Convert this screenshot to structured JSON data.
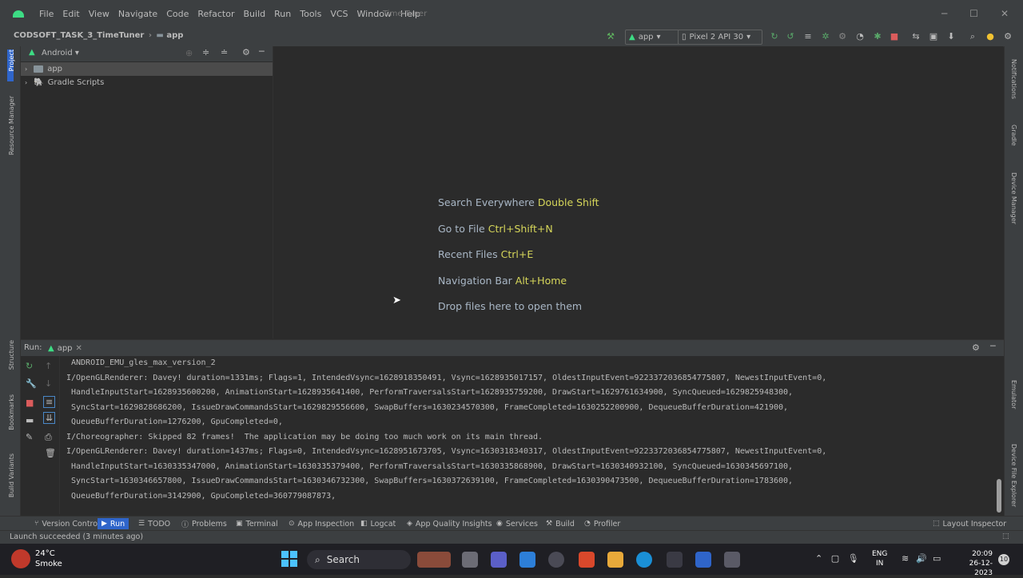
{
  "menu": [
    "File",
    "Edit",
    "View",
    "Navigate",
    "Code",
    "Refactor",
    "Build",
    "Run",
    "Tools",
    "VCS",
    "Window",
    "Help"
  ],
  "window_title": "Time Tuner",
  "breadcrumb": {
    "project": "CODSOFT_TASK_3_TimeTuner",
    "module": "app"
  },
  "toolbar": {
    "run_config": "app",
    "device": "Pixel 2 API 30"
  },
  "project_panel": {
    "view": "Android",
    "items": [
      {
        "label": "app"
      },
      {
        "label": "Gradle Scripts"
      }
    ]
  },
  "left_stripe": {
    "project": "Project",
    "resource_manager": "Resource Manager",
    "structure": "Structure",
    "bookmarks": "Bookmarks",
    "build_variants": "Build Variants"
  },
  "right_stripe": {
    "notifications": "Notifications",
    "gradle": "Gradle",
    "device_manager": "Device Manager",
    "emulator": "Emulator",
    "device_file_explorer": "Device File Explorer"
  },
  "editor_hints": [
    {
      "label": "Search Everywhere",
      "key": "Double Shift"
    },
    {
      "label": "Go to File",
      "key": "Ctrl+Shift+N"
    },
    {
      "label": "Recent Files",
      "key": "Ctrl+E"
    },
    {
      "label": "Navigation Bar",
      "key": "Alt+Home"
    },
    {
      "label": "Drop files here to open them",
      "key": ""
    }
  ],
  "run_panel": {
    "title": "Run:",
    "tab": "app",
    "lines": [
      "ANDROID_EMU_gles_max_version_2",
      "I/OpenGLRenderer: Davey! duration=1331ms; Flags=1, IntendedVsync=1628918350491, Vsync=1628935017157, OldestInputEvent=9223372036854775807, NewestInputEvent=0,",
      "HandleInputStart=1628935600200, AnimationStart=1628935641400, PerformTraversalsStart=1628935759200, DrawStart=1629761634900, SyncQueued=1629825948300,",
      "SyncStart=1629828686200, IssueDrawCommandsStart=1629829556600, SwapBuffers=1630234570300, FrameCompleted=1630252200900, DequeueBufferDuration=421900,",
      "QueueBufferDuration=1276200, GpuCompleted=0,",
      "I/Choreographer: Skipped 82 frames!  The application may be doing too much work on its main thread.",
      "I/OpenGLRenderer: Davey! duration=1437ms; Flags=0, IntendedVsync=1628951673705, Vsync=1630318340317, OldestInputEvent=9223372036854775807, NewestInputEvent=0,",
      "HandleInputStart=1630335347000, AnimationStart=1630335379400, PerformTraversalsStart=1630335868900, DrawStart=1630340932100, SyncQueued=1630345697100,",
      "SyncStart=1630346657800, IssueDrawCommandsStart=1630346732300, SwapBuffers=1630372639100, FrameCompleted=1630390473500, DequeueBufferDuration=1783600,",
      "QueueBufferDuration=3142900, GpuCompleted=360779087873,"
    ]
  },
  "bottom_tabs": [
    {
      "label": "Version Control",
      "icon": "branch-icon"
    },
    {
      "label": "Run",
      "icon": "play-icon",
      "active": true
    },
    {
      "label": "TODO",
      "icon": "list-icon"
    },
    {
      "label": "Problems",
      "icon": "info-icon"
    },
    {
      "label": "Terminal",
      "icon": "terminal-icon"
    },
    {
      "label": "App Inspection",
      "icon": "inspect-icon"
    },
    {
      "label": "Logcat",
      "icon": "logcat-icon"
    },
    {
      "label": "App Quality Insights",
      "icon": "insights-icon"
    },
    {
      "label": "Services",
      "icon": "services-icon"
    },
    {
      "label": "Build",
      "icon": "hammer-icon"
    },
    {
      "label": "Profiler",
      "icon": "profiler-icon"
    }
  ],
  "layout_inspector": "Layout Inspector",
  "status": "Launch succeeded (3 minutes ago)",
  "taskbar": {
    "weather_temp": "24°C",
    "weather_desc": "Smoke",
    "search": "Search",
    "lang": "ENG",
    "region": "IN",
    "time": "20:09",
    "date": "26-12-2023",
    "notif_count": "10"
  },
  "colors": {
    "accent": "#2f65ca",
    "android_green": "#3ddc84",
    "key_yellow": "#d6d65a"
  }
}
